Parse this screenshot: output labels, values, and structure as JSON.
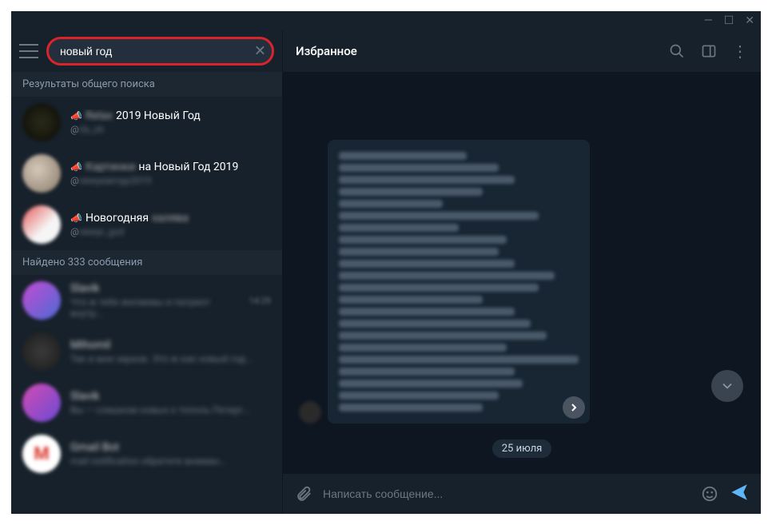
{
  "titlebar": {
    "min": "—",
    "max": "☐",
    "close": "✕"
  },
  "search": {
    "value": "новый год",
    "clear": "✕"
  },
  "sections": {
    "global_header": "Результаты общего поиска",
    "messages_header": "Найдено 333 сообщения"
  },
  "global_results": [
    {
      "title_prefix": "Relax",
      "title": "2019 Новый Год",
      "prefix_blur": true,
      "handle_prefix": "@",
      "handle": "rlx_ch"
    },
    {
      "title_prefix": "Картинки",
      "title": "на Новый Год 2019",
      "prefix_blur": true,
      "handle_prefix": "@",
      "handle": "newyearnyp2019"
    },
    {
      "title_prefix": "",
      "title": "Новогодняя",
      "title_suffix": "халява",
      "suffix_blur": true,
      "handle_prefix": "@",
      "handle": "newyr_gvd"
    }
  ],
  "message_results": [
    {
      "name": "Slavik",
      "preview": "Что ж тебе желаемы и патриот внутр...",
      "meta": "14:29"
    },
    {
      "name": "Mihomil",
      "preview": "Так и мне зараза. Это ж как новый год...",
      "meta": ""
    },
    {
      "name": "Slavik",
      "preview": "Вы — слишком новых к тополь Петерг...",
      "meta": ""
    },
    {
      "name": "Gmail Bot",
      "preview": "mail notification обратите вниман...",
      "meta": ""
    }
  ],
  "chat": {
    "title": "Избранное",
    "date_label": "25 июля",
    "compose_placeholder": "Написать сообщение..."
  },
  "bubble_lines": [
    180,
    200,
    230,
    220,
    300,
    210,
    260,
    240,
    220,
    180,
    250,
    270,
    220,
    200,
    210,
    150,
    250,
    130,
    180,
    220,
    200,
    160
  ]
}
